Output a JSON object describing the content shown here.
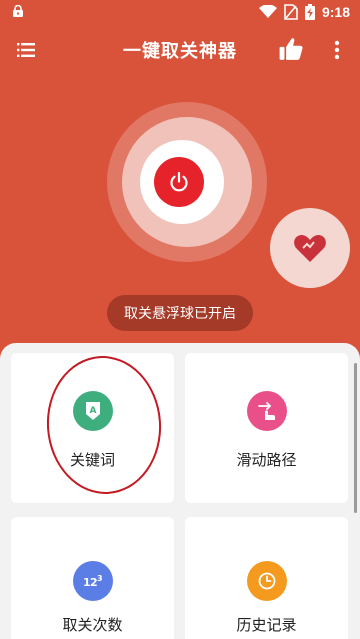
{
  "statusbar": {
    "time": "9:18",
    "icons": [
      "lock-icon",
      "wifi-icon",
      "no-sim-icon",
      "battery-charging-icon"
    ]
  },
  "appbar": {
    "title": "一键取关神器",
    "icons": [
      "menu-icon",
      "thumbs-up-icon",
      "more-vert-icon"
    ]
  },
  "main": {
    "power_icon": "power-icon",
    "heart_icon": "heart-icon",
    "status_text": "取关悬浮球已开启"
  },
  "cards": [
    {
      "label": "关键词",
      "icon": "keyword-tag-icon",
      "color": "#3fae7e"
    },
    {
      "label": "滑动路径",
      "icon": "swipe-gesture-icon",
      "color": "#e9508a"
    },
    {
      "label": "取关次数",
      "icon": "numbers-123-icon",
      "color": "#5a7de6"
    },
    {
      "label": "历史记录",
      "icon": "clock-icon",
      "color": "#f39a1f"
    }
  ],
  "colors": {
    "background": "#d9533a",
    "power_red": "#e6232b",
    "pill": "#a53a29",
    "annotation": "#c41a24"
  }
}
